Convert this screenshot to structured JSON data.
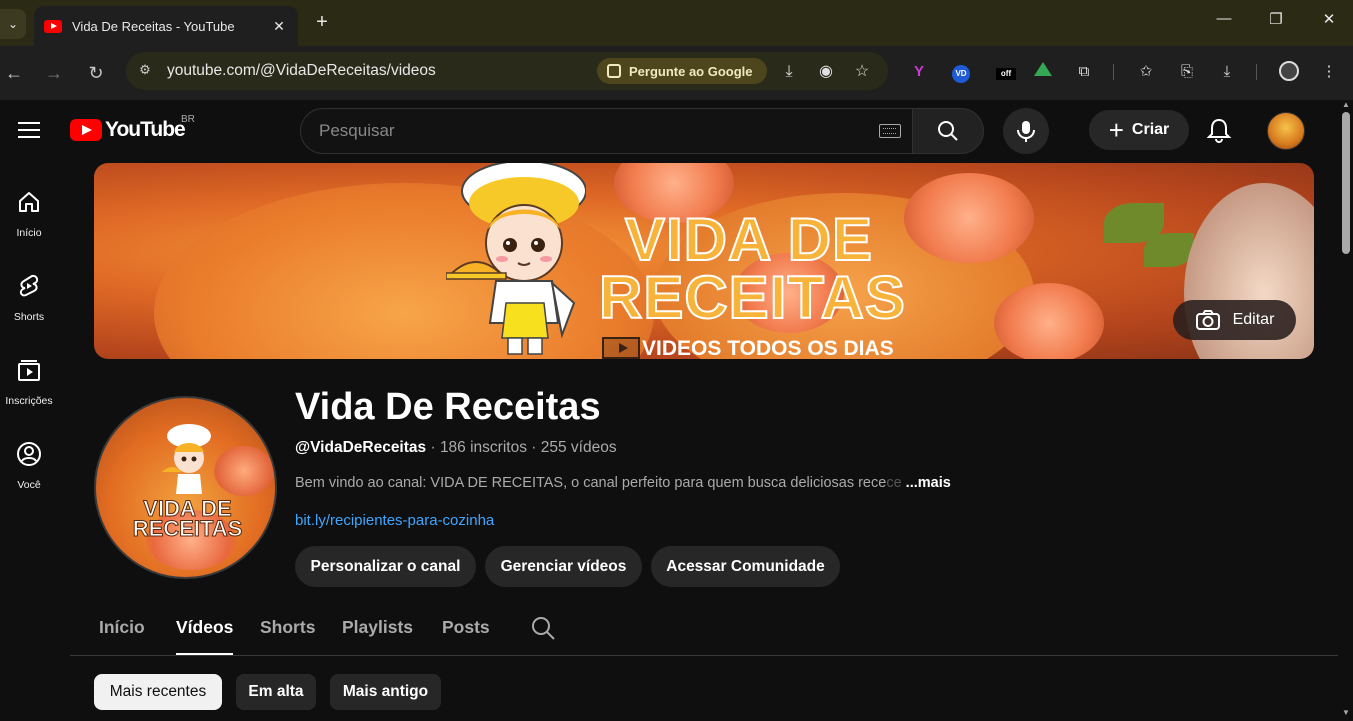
{
  "browser": {
    "tab_title": "Vida De Receitas - YouTube",
    "new_tab_label": "+",
    "url": "youtube.com/@VidaDeReceitas/videos",
    "google_button": "Pergunte ao Google",
    "window_controls": {
      "minimize": "—",
      "restore": "❐",
      "close": "✕"
    },
    "tab_close": "✕"
  },
  "header": {
    "logo_text": "YouTube",
    "region": "BR",
    "search_placeholder": "Pesquisar",
    "create_label": "Criar"
  },
  "guide": [
    {
      "label": "Início",
      "icon": "home-icon"
    },
    {
      "label": "Shorts",
      "icon": "shorts-icon"
    },
    {
      "label": "Inscrições",
      "icon": "subscriptions-icon"
    },
    {
      "label": "Você",
      "icon": "you-icon"
    }
  ],
  "banner": {
    "title_line1": "VIDA DE",
    "title_line2": "RECEITAS",
    "subtitle": "VIDEOS TODOS OS DIAS",
    "edit_label": "Editar"
  },
  "channel": {
    "avatar_line1": "VIDA DE",
    "avatar_line2": "RECEITAS",
    "name": "Vida De Receitas",
    "handle": "@VidaDeReceitas",
    "subscribers": "186 inscritos",
    "videos": "255 vídeos",
    "description": "Bem vindo ao canal: VIDA DE RECEITAS, o canal perfeito para quem busca deliciosas rece",
    "description_fade": "ce",
    "more_label": "...mais",
    "link": "bit.ly/recipientes-para-cozinha",
    "buttons": [
      "Personalizar o canal",
      "Gerenciar vídeos",
      "Acessar Comunidade"
    ]
  },
  "tabs": [
    "Início",
    "Vídeos",
    "Shorts",
    "Playlists",
    "Posts"
  ],
  "active_tab": "Vídeos",
  "chips": [
    "Mais recentes",
    "Em alta",
    "Mais antigo"
  ],
  "active_chip": "Mais recentes",
  "colors": {
    "accent_red": "#ff0000",
    "link_blue": "#3ea6ff",
    "background": "#0f0f0f",
    "chip_bg": "#272727"
  }
}
